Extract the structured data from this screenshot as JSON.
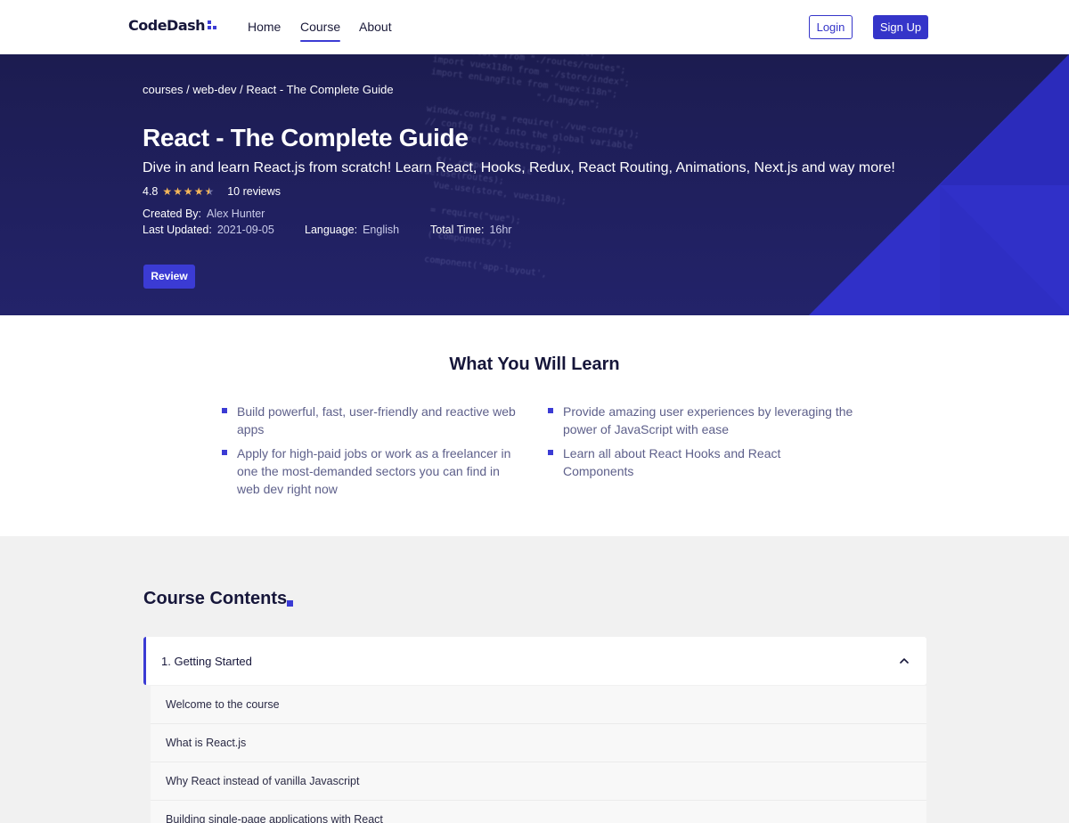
{
  "brand": {
    "name": "CodeDash",
    "accent": "#3b3bd4"
  },
  "nav": {
    "links": [
      "Home",
      "Course",
      "About"
    ],
    "active": "Course",
    "login": "Login",
    "signup": "Sign Up"
  },
  "hero": {
    "breadcrumb": "courses / web-dev / React - The Complete Guide",
    "title": "React - The Complete Guide",
    "subtitle": "Dive in and learn React.js from scratch! Learn React, Hooks, Redux, React Routing, Animations, Next.js and way more!",
    "rating": "4.8",
    "rating_value": 4.5,
    "reviews": "10 reviews",
    "created_by_label": "Created By:",
    "created_by": "Alex Hunter",
    "updated_label": "Last Updated:",
    "updated": "2021-09-05",
    "language_label": "Language:",
    "language": "English",
    "total_time_label": "Total Time:",
    "total_time": "16hr",
    "review_button": "Review",
    "code_lines": [
      "import routes from \"vue-router\";",
      "import store from \"./routes/routes\";",
      "import vuex118n from \"./store/index\";",
      "import enLangFile from \"vuex-i18n\";",
      "                    \"./lang/en\";",
      "",
      "window.config = require('./vue-config');",
      "// config file into the global variable",
      "   require(\"./bootstrap\");",
      "",
      "   $('.component-file",
      "Vue.use(routes);",
      "   Vue.use(store, vuex118n);",
      "",
      "   = require(\"vue\");",
      "",
      "   ('components/');",
      "",
      "   component('app-layout',"
    ]
  },
  "learn": {
    "title": "What You Will Learn",
    "items": [
      "Build powerful, fast, user-friendly and reactive web apps",
      "Provide amazing user experiences by leveraging the power of JavaScript with ease",
      "Apply for high-paid jobs or work as a freelancer in one the most-demanded sectors you can find in web dev right now",
      "Learn all about React Hooks and React Components"
    ]
  },
  "contents": {
    "title": "Course Contents",
    "section_title": "1. Getting Started",
    "lessons": [
      "Welcome to the course",
      "What is React.js",
      "Why React instead of vanilla Javascript",
      "Building single-page applications with React"
    ]
  }
}
